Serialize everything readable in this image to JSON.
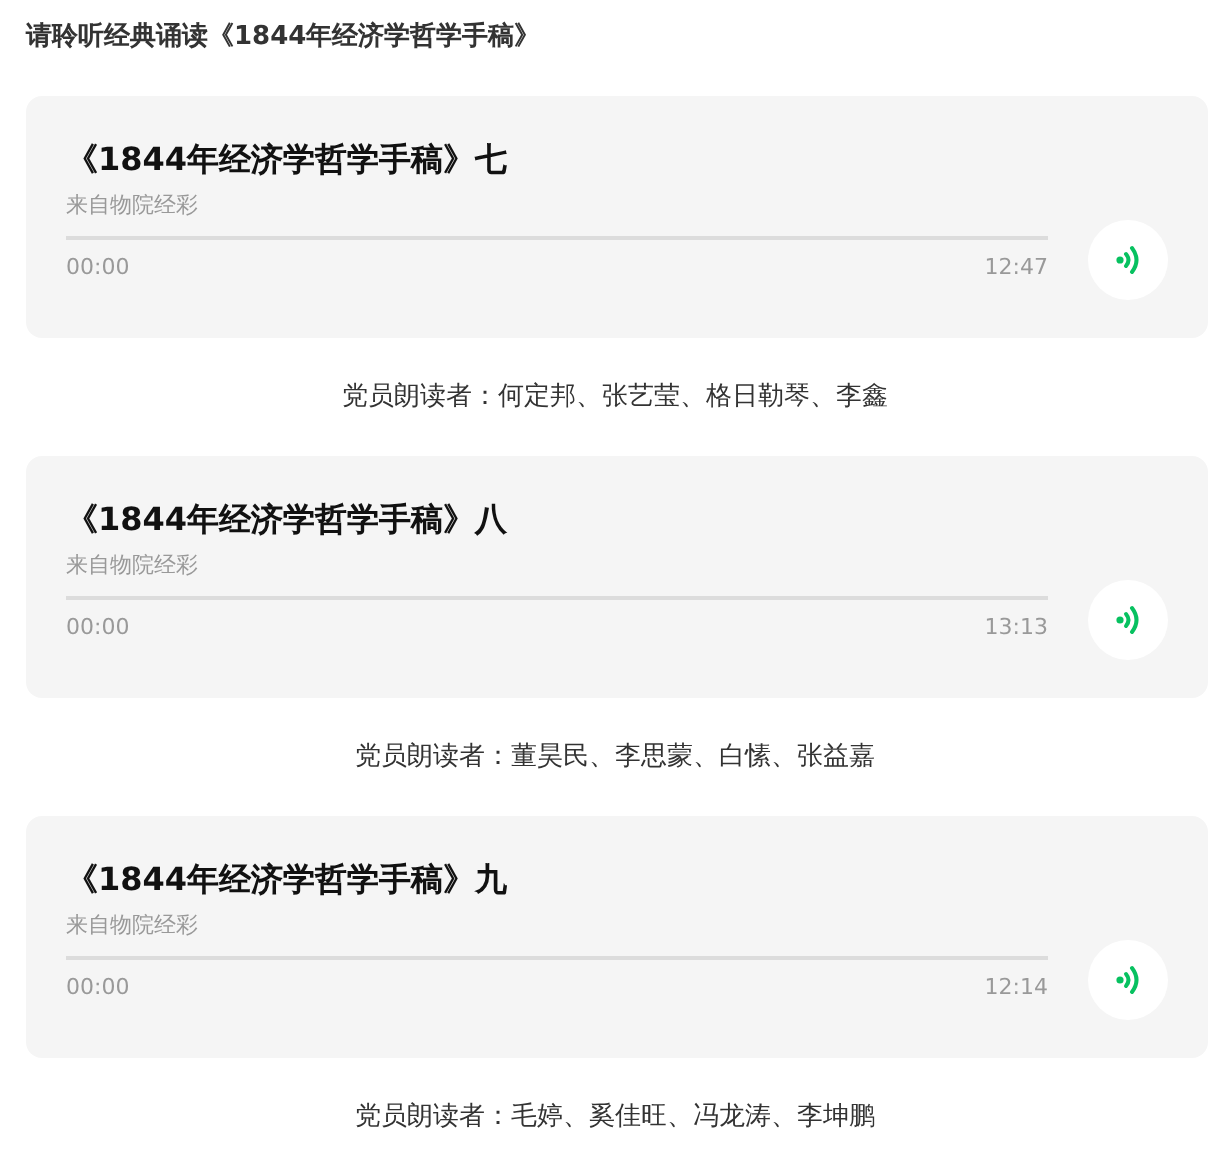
{
  "heading": "请聆听经典诵读《1844年经济学哲学手稿》",
  "tracks": [
    {
      "title": "《1844年经济学哲学手稿》七",
      "source": "来自物院经彩",
      "level": 0,
      "elapsed": "00:00",
      "duration": "12:47",
      "readers": "党员朗读者：何定邦、张艺莹、格日勒琴、李鑫"
    },
    {
      "title": "《1844年经济学哲学手稿》八",
      "source": "来自物院经彩",
      "level": 0,
      "elapsed": "00:00",
      "duration": "13:13",
      "readers": "党员朗读者：董昊民、李思蒙、白愫、张益嘉"
    },
    {
      "title": "《1844年经济学哲学手稿》九",
      "source": "来自物院经彩",
      "level": 0,
      "elapsed": "00:00",
      "duration": "12:14",
      "readers": "党员朗读者：毛婷、奚佳旺、冯龙涛、李坤鹏"
    }
  ]
}
